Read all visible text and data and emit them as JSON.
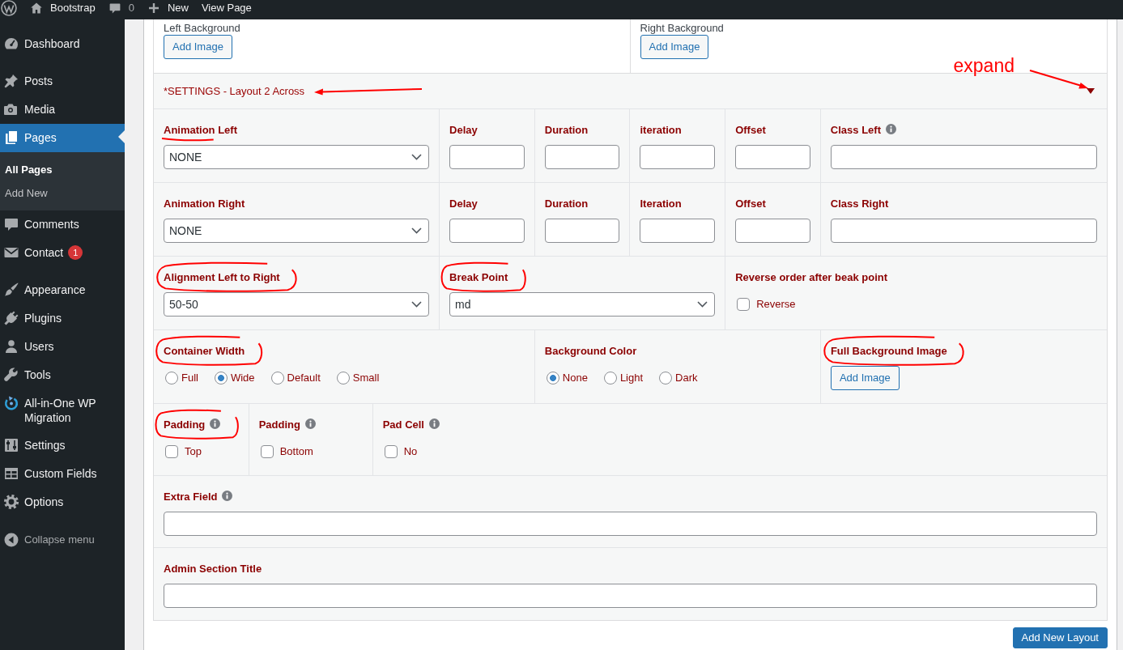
{
  "admin_bar": {
    "site_name": "Bootstrap",
    "comment_count": "0",
    "new_label": "New",
    "view_label": "View Page"
  },
  "sidebar": {
    "groups": [
      {
        "items": [
          {
            "label": "Dashboard",
            "selected": false
          }
        ]
      },
      {
        "items": [
          {
            "label": "Posts",
            "selected": false
          },
          {
            "label": "Media",
            "selected": false
          },
          {
            "label": "Pages",
            "selected": true,
            "children": [
              {
                "label": "All Pages",
                "selected": true
              },
              {
                "label": "Add New",
                "selected": false
              }
            ]
          },
          {
            "label": "Comments",
            "selected": false
          },
          {
            "label": "Contact",
            "selected": false,
            "badge": "1"
          }
        ]
      },
      {
        "items": [
          {
            "label": "Appearance",
            "selected": false
          },
          {
            "label": "Plugins",
            "selected": false
          },
          {
            "label": "Users",
            "selected": false
          },
          {
            "label": "Tools",
            "selected": false
          },
          {
            "label": "All-in-One WP Migration",
            "selected": false
          },
          {
            "label": "Settings",
            "selected": false
          },
          {
            "label": "Custom Fields",
            "selected": false
          },
          {
            "label": "Options",
            "selected": false
          }
        ]
      }
    ],
    "collapse_label": "Collapse menu"
  },
  "backgrounds": [
    {
      "label": "Left Background",
      "button": "Add Image"
    },
    {
      "label": "Right Background",
      "button": "Add Image"
    }
  ],
  "section": {
    "title": "*SETTINGS - Layout 2 Across",
    "title_arrow": true,
    "toggle_note": "expand"
  },
  "rows": [
    {
      "cells": [
        {
          "kind": "select",
          "label": "Animation Left",
          "value": "NONE",
          "underlined": true
        },
        {
          "kind": "input",
          "label": "Delay"
        },
        {
          "kind": "input",
          "label": "Duration"
        },
        {
          "kind": "input",
          "label": "iteration"
        },
        {
          "kind": "input",
          "label": "Offset"
        },
        {
          "kind": "input",
          "label": "Class Left",
          "info": true
        }
      ]
    },
    {
      "cells": [
        {
          "kind": "select",
          "label": "Animation Right",
          "value": "NONE"
        },
        {
          "kind": "input",
          "label": "Delay"
        },
        {
          "kind": "input",
          "label": "Duration"
        },
        {
          "kind": "input",
          "label": "Iteration"
        },
        {
          "kind": "input",
          "label": "Offset"
        },
        {
          "kind": "input",
          "label": "Class Right"
        }
      ]
    },
    {
      "cells": [
        {
          "kind": "select",
          "label": "Alignment Left to Right",
          "value": "50-50",
          "circled": true
        },
        {
          "kind": "select",
          "label": "Break Point",
          "value": "md",
          "circled": true
        },
        {
          "kind": "checkbox",
          "label": "Reverse order after beak point",
          "option": "Reverse",
          "checked": false
        }
      ]
    },
    {
      "cells": [
        {
          "kind": "radios",
          "label": "Container Width",
          "circled": true,
          "options": [
            {
              "label": "Full",
              "selected": false
            },
            {
              "label": "Wide",
              "selected": true
            },
            {
              "label": "Default",
              "selected": false
            },
            {
              "label": "Small",
              "selected": false
            }
          ]
        },
        {
          "kind": "radios",
          "label": "Background Color",
          "options": [
            {
              "label": "None",
              "selected": true
            },
            {
              "label": "Light",
              "selected": false
            },
            {
              "label": "Dark",
              "selected": false
            }
          ]
        },
        {
          "kind": "image",
          "label": "Full Background Image",
          "button": "Add Image",
          "circled": true
        }
      ]
    },
    {
      "cells": [
        {
          "kind": "checkbox",
          "label": "Padding",
          "option": "Top",
          "checked": false,
          "info": true,
          "circled": true
        },
        {
          "kind": "checkbox",
          "label": "Padding",
          "option": "Bottom",
          "checked": false,
          "info": true
        },
        {
          "kind": "checkbox",
          "label": "Pad Cell",
          "option": "No",
          "checked": false,
          "info": true
        }
      ]
    },
    {
      "cells": [
        {
          "kind": "input",
          "label": "Extra Field",
          "info": true
        }
      ]
    },
    {
      "cells": [
        {
          "kind": "input",
          "label": "Admin Section Title"
        }
      ]
    }
  ],
  "add_layout_button": "Add New Layout"
}
